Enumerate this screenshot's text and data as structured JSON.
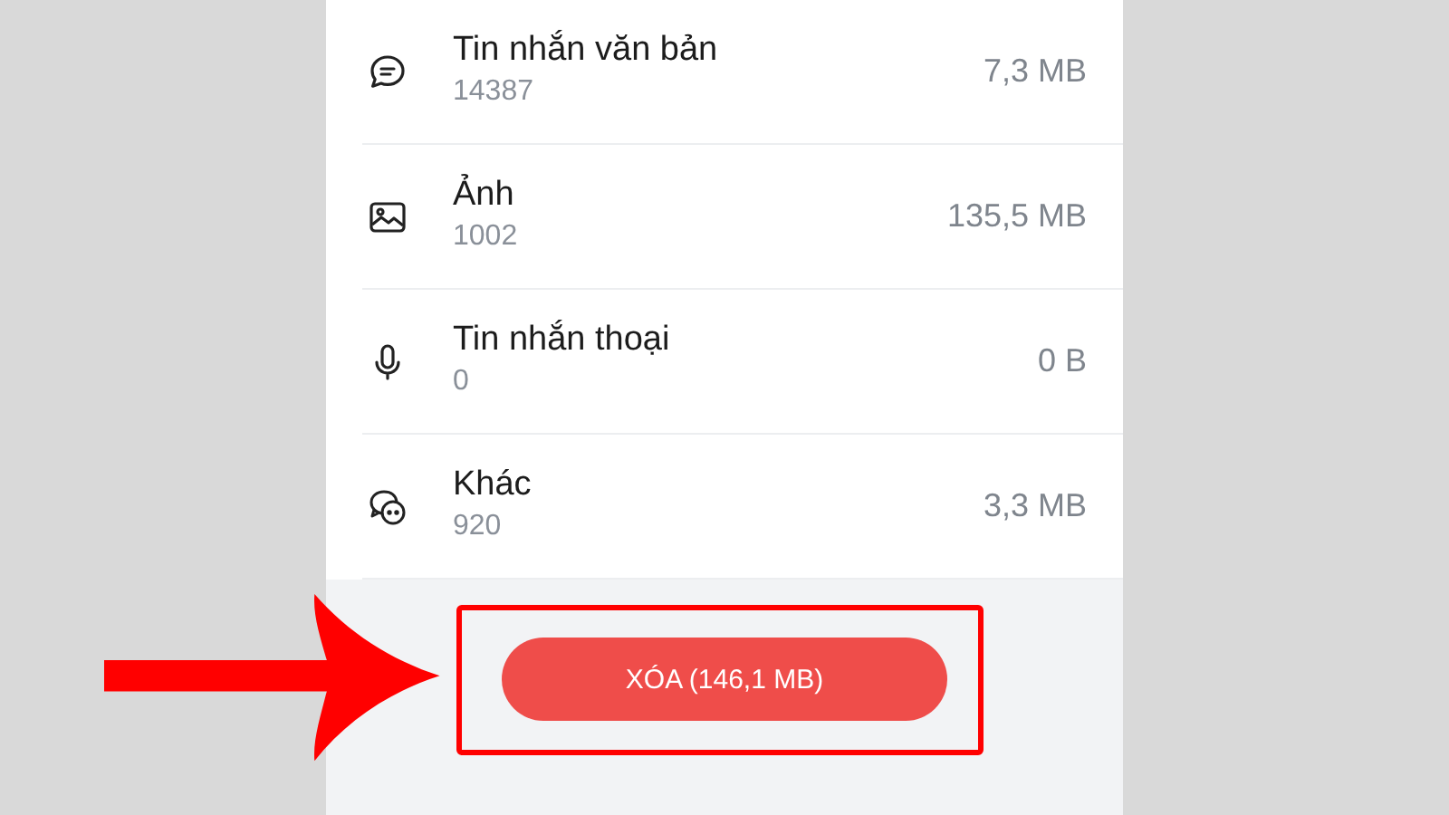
{
  "items": [
    {
      "kind": "message",
      "title": "Tin nhắn văn bản",
      "count": "14387",
      "size": "7,3 MB"
    },
    {
      "kind": "image",
      "title": "Ảnh",
      "count": "1002",
      "size": "135,5 MB"
    },
    {
      "kind": "voice",
      "title": "Tin nhắn thoại",
      "count": "0",
      "size": "0 B"
    },
    {
      "kind": "other",
      "title": "Khác",
      "count": "920",
      "size": "3,3 MB"
    }
  ],
  "delete_button": {
    "label": "XÓA (146,1 MB)"
  }
}
